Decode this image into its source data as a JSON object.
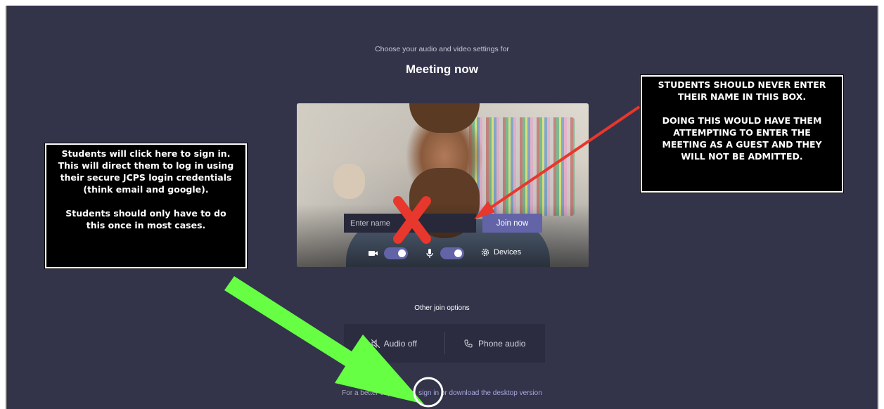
{
  "meeting": {
    "subtitle": "Choose your audio and video settings for",
    "title": "Meeting now"
  },
  "prejoin": {
    "name_placeholder": "Enter name",
    "join_label": "Join now",
    "devices_label": "Devices",
    "camera_on": true,
    "mic_on": true
  },
  "other_options": {
    "label": "Other join options",
    "audio_off": "Audio off",
    "phone_audio": "Phone audio"
  },
  "footer": {
    "prefix": "For a better experience,",
    "sign_in": "sign in",
    "middle": "or",
    "download": "download the desktop version"
  },
  "annotations": {
    "left_callout": {
      "line1": "Students will click here to sign in.",
      "line2": "This will direct them to log in using",
      "line3": "their secure JCPS login credentials",
      "line4": "(think email and google).",
      "line5": "Students should only have to do",
      "line6": "this once in most cases."
    },
    "right_callout": {
      "line1": "STUDENTS SHOULD NEVER ENTER",
      "line2": "THEIR NAME IN THIS BOX.",
      "line3": "DOING THIS WOULD HAVE THEM",
      "line4": "ATTEMPTING TO ENTER THE",
      "line5": "MEETING AS A GUEST AND THEY",
      "line6": "WILL NOT BE ADMITTED."
    }
  },
  "colors": {
    "background": "#33344a",
    "accent": "#6264a7",
    "red_arrow": "#e8372c",
    "green_arrow": "#66ff44"
  }
}
